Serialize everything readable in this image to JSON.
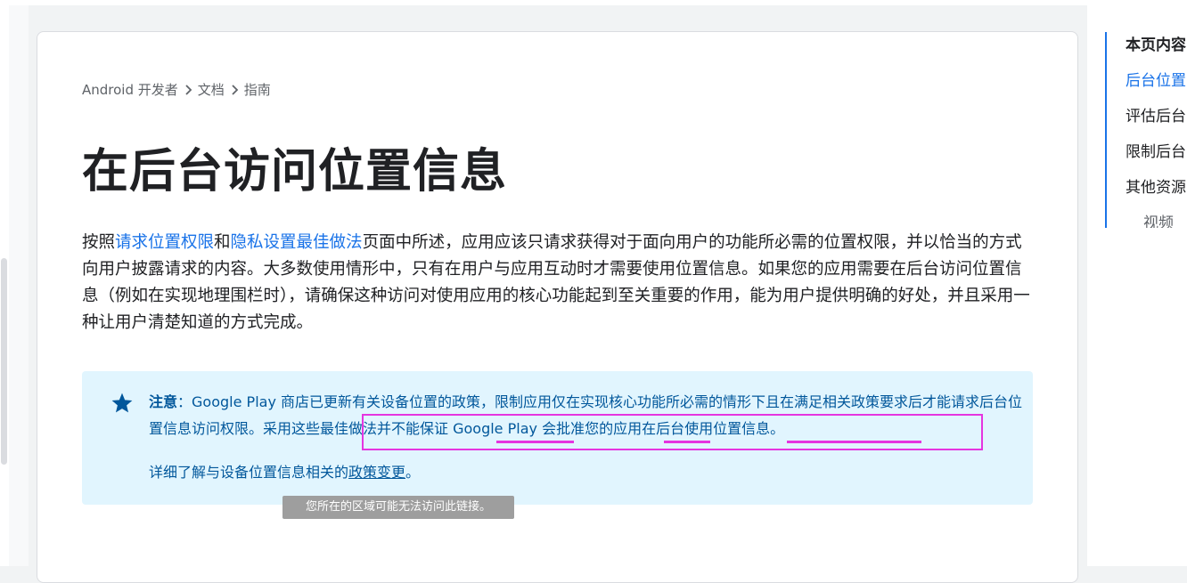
{
  "breadcrumb": {
    "items": [
      "Android 开发者",
      "文档",
      "指南"
    ]
  },
  "page": {
    "title": "在后台访问位置信息"
  },
  "intro": {
    "prefix": "按照",
    "link1": "请求位置权限",
    "and": "和",
    "link2": "隐私设置最佳做法",
    "rest": "页面中所述，应用应该只请求获得对于面向用户的功能所必需的位置权限，并以恰当的方式向用户披露请求的内容。大多数使用情形中，只有在用户与应用互动时才需要使用位置信息。如果您的应用需要在后台访问位置信息（例如在实现地理围栏时），请确保这种访问对使用应用的核心功能起到至关重要的作用，能为用户提供明确的好处，并且采用一种让用户清楚知道的方式完成。"
  },
  "note": {
    "icon": "star-icon",
    "label": "注意",
    "colon": "：",
    "text1": "Google Play 商店已更新有关设备位置的政策，限制应用仅在实现核心功能所必需的情形下且在满足相关政策要求后才能请求后台位置信息访问权限。",
    "link": "采用这些最佳做法并不能保证 Google Play 会批准您的应用在后台使用位置信息。",
    "line2_prefix": "详细了解与设备位置信息相关的",
    "line2_link": "政策变更",
    "line2_suffix": "。"
  },
  "tooltip": {
    "text": "您所在的区域可能无法访问此链接。"
  },
  "toc": {
    "title": "本页内容",
    "items": [
      "后台位置",
      "评估后台",
      "限制后台",
      "其他资源"
    ],
    "sub_items": [
      "视频"
    ]
  },
  "colors": {
    "link": "#1a73e8",
    "note_bg": "#e1f5fe",
    "note_text": "#01579b",
    "highlight": "#e535e0"
  }
}
